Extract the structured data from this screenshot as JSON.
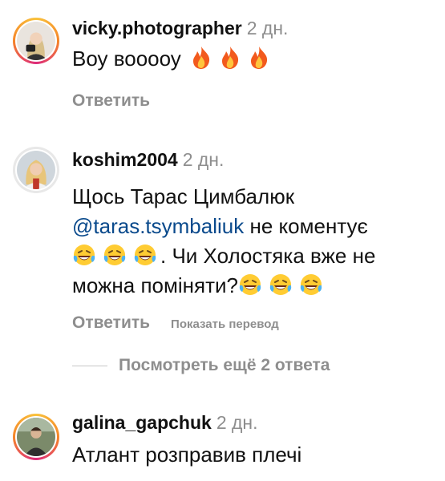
{
  "comments": [
    {
      "username": "vicky.photographer",
      "time": "2 дн.",
      "text": "Воу вооооу",
      "emojis": [
        "fire-icon",
        "fire-icon",
        "fire-icon"
      ],
      "reply_label": "Ответить"
    },
    {
      "username": "koshim2004",
      "time": "2 дн.",
      "text_line1": "Щось Тарас Цимбалюк",
      "mention": "@taras.tsymbaliuk",
      "text_line2_rest": " не коментує",
      "text_line3_rest": ". Чи Холостяка вже не",
      "text_line4": "можна поміняти?",
      "emojis": [
        "laughing-tears-icon",
        "laughing-tears-icon",
        "laughing-tears-icon"
      ],
      "reply_label": "Ответить",
      "translate_label": "Показать перевод"
    },
    {
      "username": "galina_gapchuk",
      "time": "2 дн.",
      "text": "Атлант розправив плечі"
    }
  ],
  "view_replies_label": "Посмотреть ещё 2 ответа",
  "colors": {
    "muted": "#8e8e8e",
    "mention": "#0a4a8c"
  }
}
